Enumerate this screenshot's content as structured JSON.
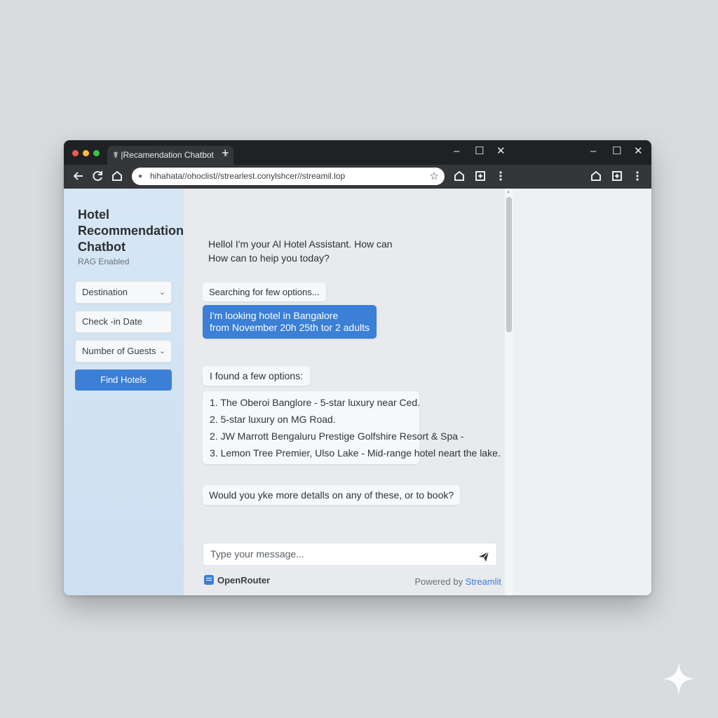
{
  "browser": {
    "tab_title": "☤ |Recamendation Chatbot",
    "tab_close": "×",
    "new_tab": "+",
    "url": "hihahata//ohoclist//strearlest.conylshcer//streamil.lop",
    "window_controls": [
      "–",
      "☐",
      "✕"
    ]
  },
  "sidebar": {
    "title": "Hotel Recommendation Chatbot",
    "subtitle": "RAG Enabled",
    "destination_label": "Destination",
    "checkin_label": "Check -in Date",
    "guests_label": "Number of Guests",
    "find_button": "Find Hotels"
  },
  "chat": {
    "greeting_line1": "Hellol I'm your Al Hotel Assistant. How can",
    "greeting_line2": "How can to heip you today?",
    "searching": "Searching for few options...",
    "user_line1": "I'm looking hotel in Bangalore",
    "user_line2": "from November 20h 25th tor 2 adults",
    "found": "I found a few options:",
    "options": [
      "1.  The Oberoi Banglore - 5-star luxury near Ced.",
      "2. 5-star luxury on MG Road.",
      "2.  JW Marrott Bengaluru Prestige Golfshire Resort & Spa -",
      "3.  Lemon Tree Premier, Ulso Lake - Mid-range hotel neart the lake."
    ],
    "followup": "Would you yke more detalls on any of these, or to book?",
    "input_placeholder": "Type your message...",
    "footer_brand": "OpenRouter",
    "powered_prefix": "Powered by ",
    "powered_brand": "Streamlit"
  },
  "colors": {
    "accent": "#3b7fd6",
    "titlebar": "#202124",
    "toolbar": "#35363a",
    "sidebar": "#d6e6f4"
  },
  "icons": [
    "back-arrow-icon",
    "reload-icon",
    "home-icon",
    "lock-icon",
    "star-icon",
    "extension-icon",
    "menu-dots-icon",
    "chevron-down-icon",
    "send-icon",
    "openrouter-logo-icon",
    "sparkle-icon"
  ]
}
